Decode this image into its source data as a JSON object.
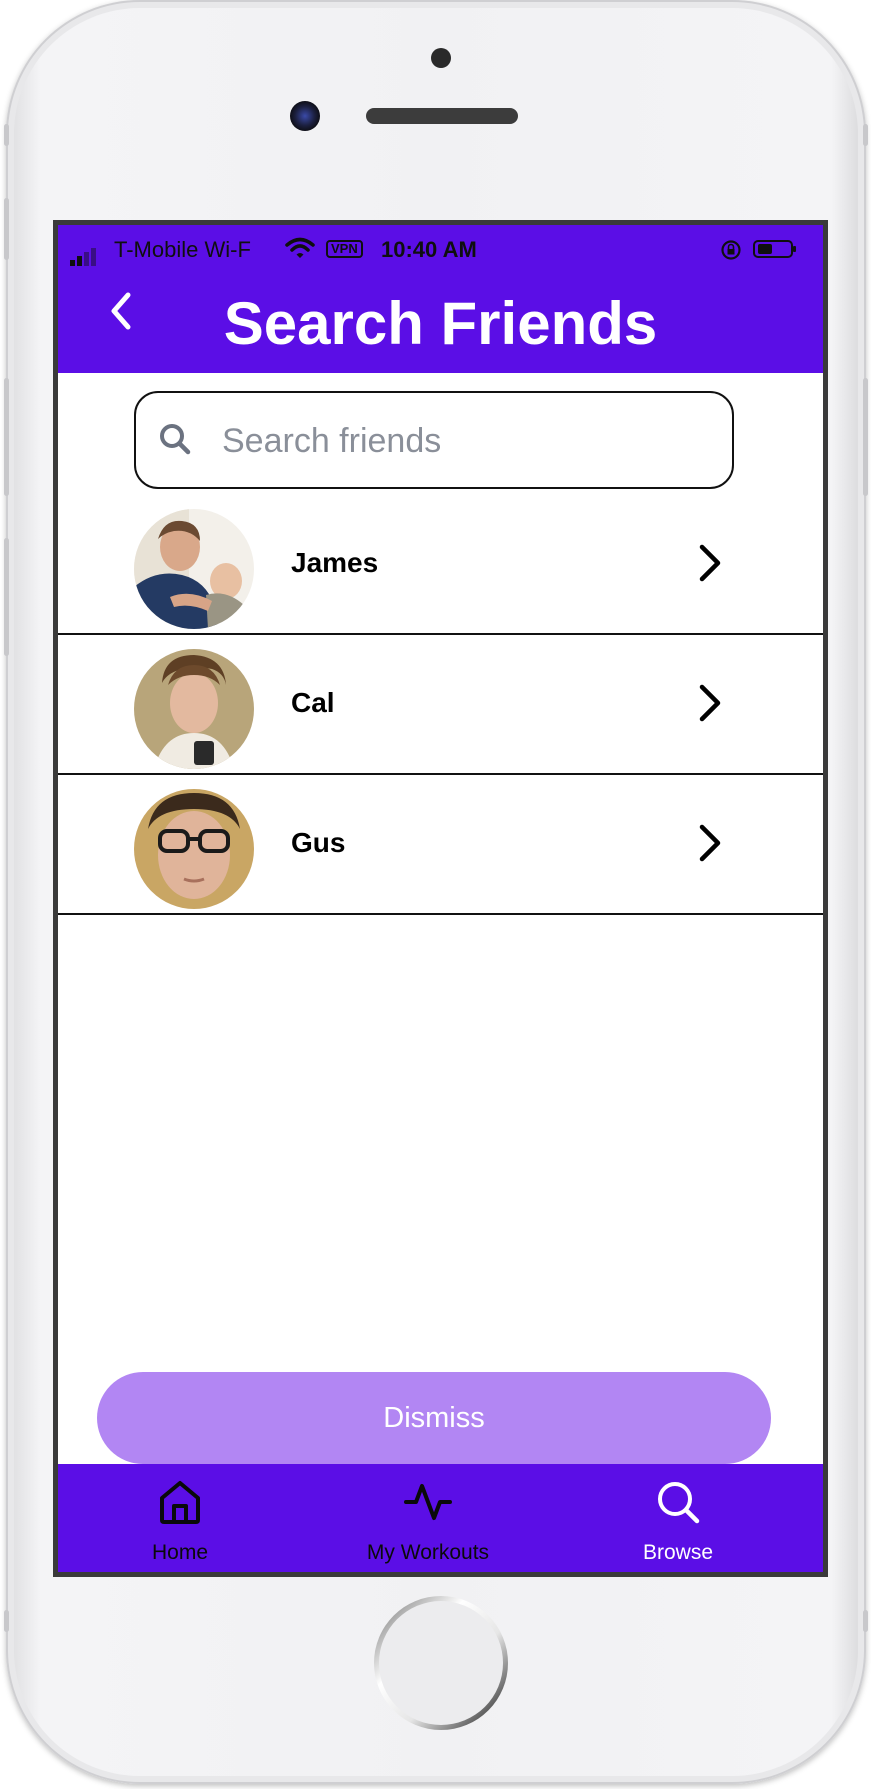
{
  "status_bar": {
    "carrier": "T-Mobile Wi-F",
    "vpn": "VPN",
    "time": "10:40 AM"
  },
  "header": {
    "title": "Search Friends",
    "color": "#5b0ee6"
  },
  "search": {
    "placeholder": "Search friends",
    "value": ""
  },
  "friends": [
    {
      "name": "James"
    },
    {
      "name": "Cal"
    },
    {
      "name": "Gus"
    }
  ],
  "dismiss_label": "Dismiss",
  "tabs": [
    {
      "label": "Home",
      "icon": "home-icon",
      "color": "#0a0a0a"
    },
    {
      "label": "My Workouts",
      "icon": "activity-icon",
      "color": "#0a0a0a"
    },
    {
      "label": "Browse",
      "icon": "search-icon",
      "color": "#ffffff"
    }
  ],
  "colors": {
    "accent": "#5b0ee6",
    "dismiss": "#b286f3"
  }
}
